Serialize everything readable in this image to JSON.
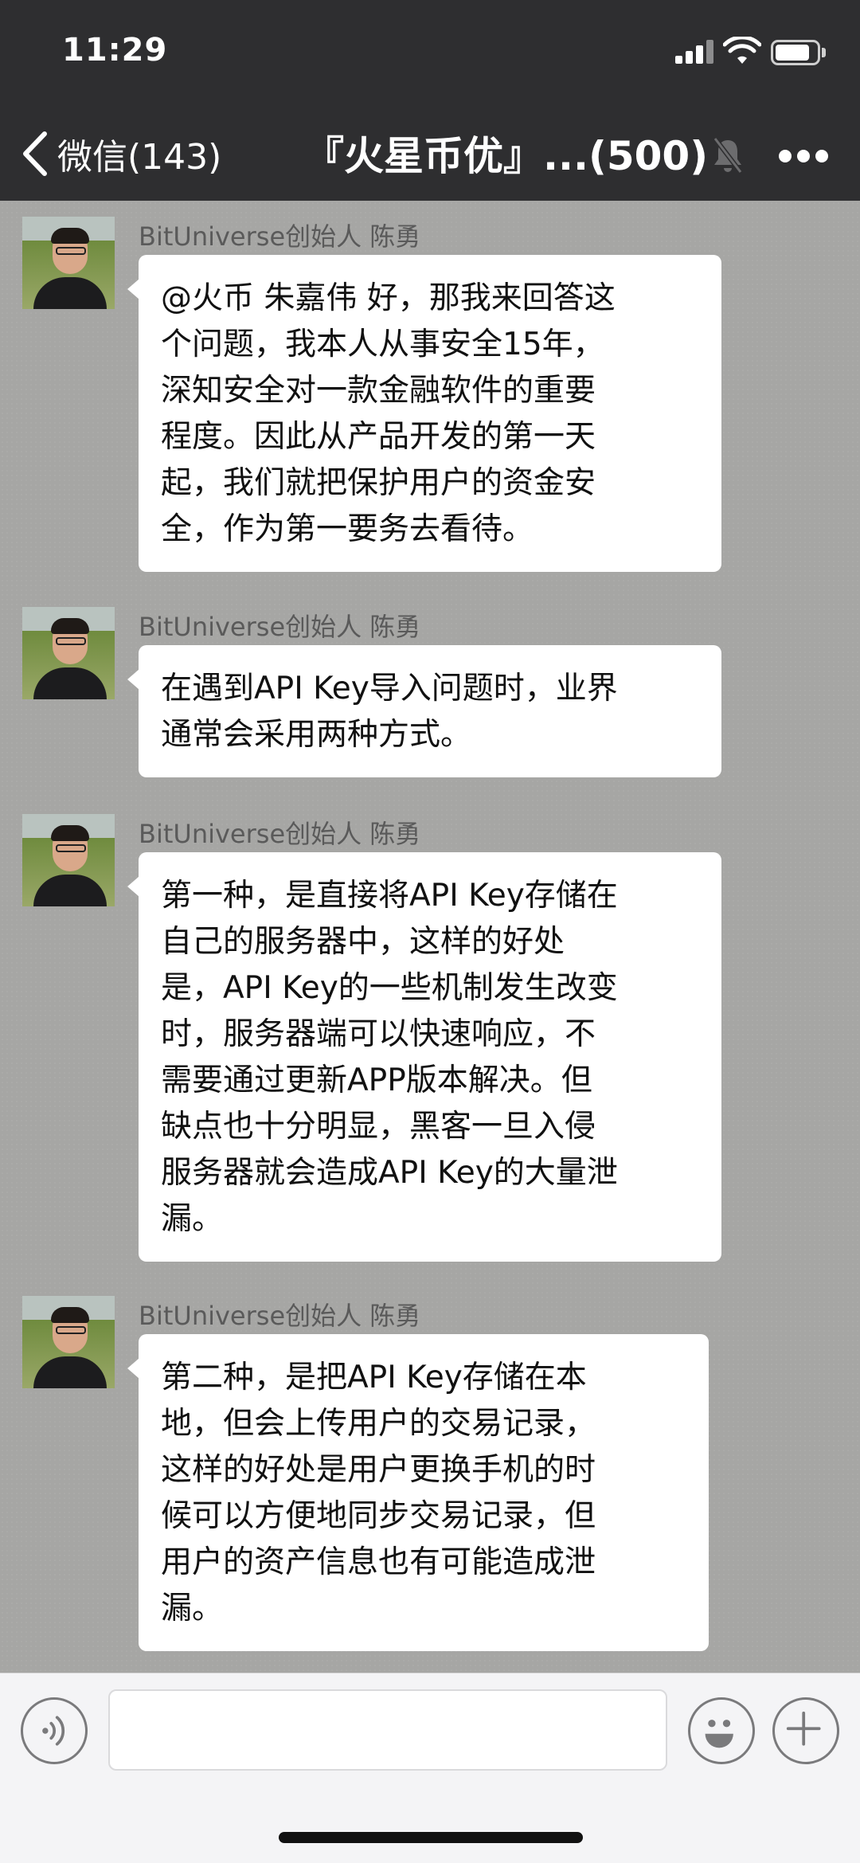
{
  "status_bar": {
    "time": "11:29"
  },
  "nav": {
    "back_label": "微信(143)",
    "title": "『火星币优』...(500)",
    "mute_icon": "bell-muted-icon",
    "more_icon": "more-dots-icon"
  },
  "messages": [
    {
      "sender": "BitUniverse创始人 陈勇",
      "text": "@火币 朱嘉伟 好，那我来回答这\n个问题，我本人从事安全15年，\n深知安全对一款金融软件的重要\n程度。因此从产品开发的第一天\n起，我们就把保护用户的资金安\n全，作为第一要务去看待。"
    },
    {
      "sender": "BitUniverse创始人 陈勇",
      "text": "在遇到API Key导入问题时，业界\n通常会采用两种方式。"
    },
    {
      "sender": "BitUniverse创始人 陈勇",
      "text": "第一种，是直接将API Key存储在\n自己的服务器中，这样的好处\n是，API Key的一些机制发生改变\n时，服务器端可以快速响应，不\n需要通过更新APP版本解决。但\n缺点也十分明显，黑客一旦入侵\n服务器就会造成API Key的大量泄\n漏。"
    },
    {
      "sender": "BitUniverse创始人 陈勇",
      "text": "第二种，是把API Key存储在本\n地，但会上传用户的交易记录，\n这样的好处是用户更换手机的时\n候可以方便地同步交易记录，但\n用户的资产信息也有可能造成泄\n漏。"
    }
  ],
  "input_bar": {
    "voice_icon": "voice-icon",
    "emoji_icon": "emoji-icon",
    "plus_icon": "plus-icon",
    "message_value": ""
  }
}
